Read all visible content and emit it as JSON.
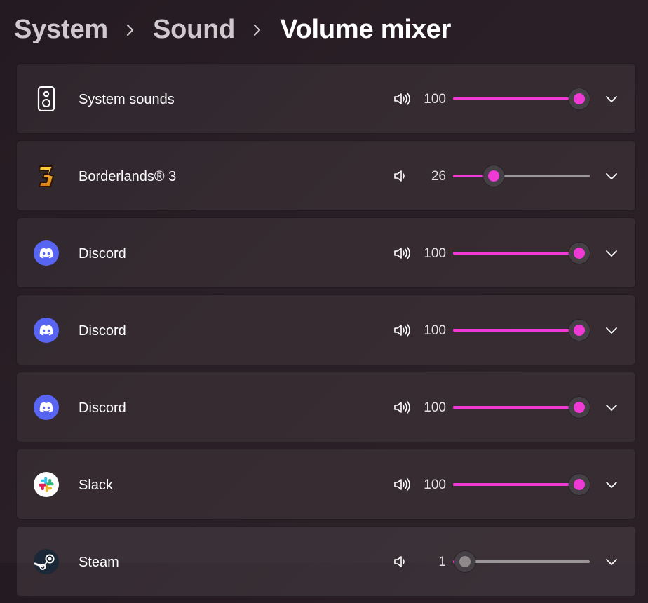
{
  "breadcrumb": {
    "items": [
      "System",
      "Sound"
    ],
    "current": "Volume mixer"
  },
  "colors": {
    "accent": "#f03ad6",
    "discord": "#5865f2",
    "track": "#9a9597"
  },
  "apps": [
    {
      "name": "System sounds",
      "icon": "speaker-device-icon",
      "volume": "100",
      "level": 100
    },
    {
      "name": "Borderlands® 3",
      "icon": "borderlands-3-icon",
      "volume": "26",
      "level": 26
    },
    {
      "name": "Discord",
      "icon": "discord-icon",
      "volume": "100",
      "level": 100
    },
    {
      "name": "Discord",
      "icon": "discord-icon",
      "volume": "100",
      "level": 100
    },
    {
      "name": "Discord",
      "icon": "discord-icon",
      "volume": "100",
      "level": 100
    },
    {
      "name": "Slack",
      "icon": "slack-icon",
      "volume": "100",
      "level": 100
    },
    {
      "name": "Steam",
      "icon": "steam-icon",
      "volume": "1",
      "level": 1
    }
  ]
}
